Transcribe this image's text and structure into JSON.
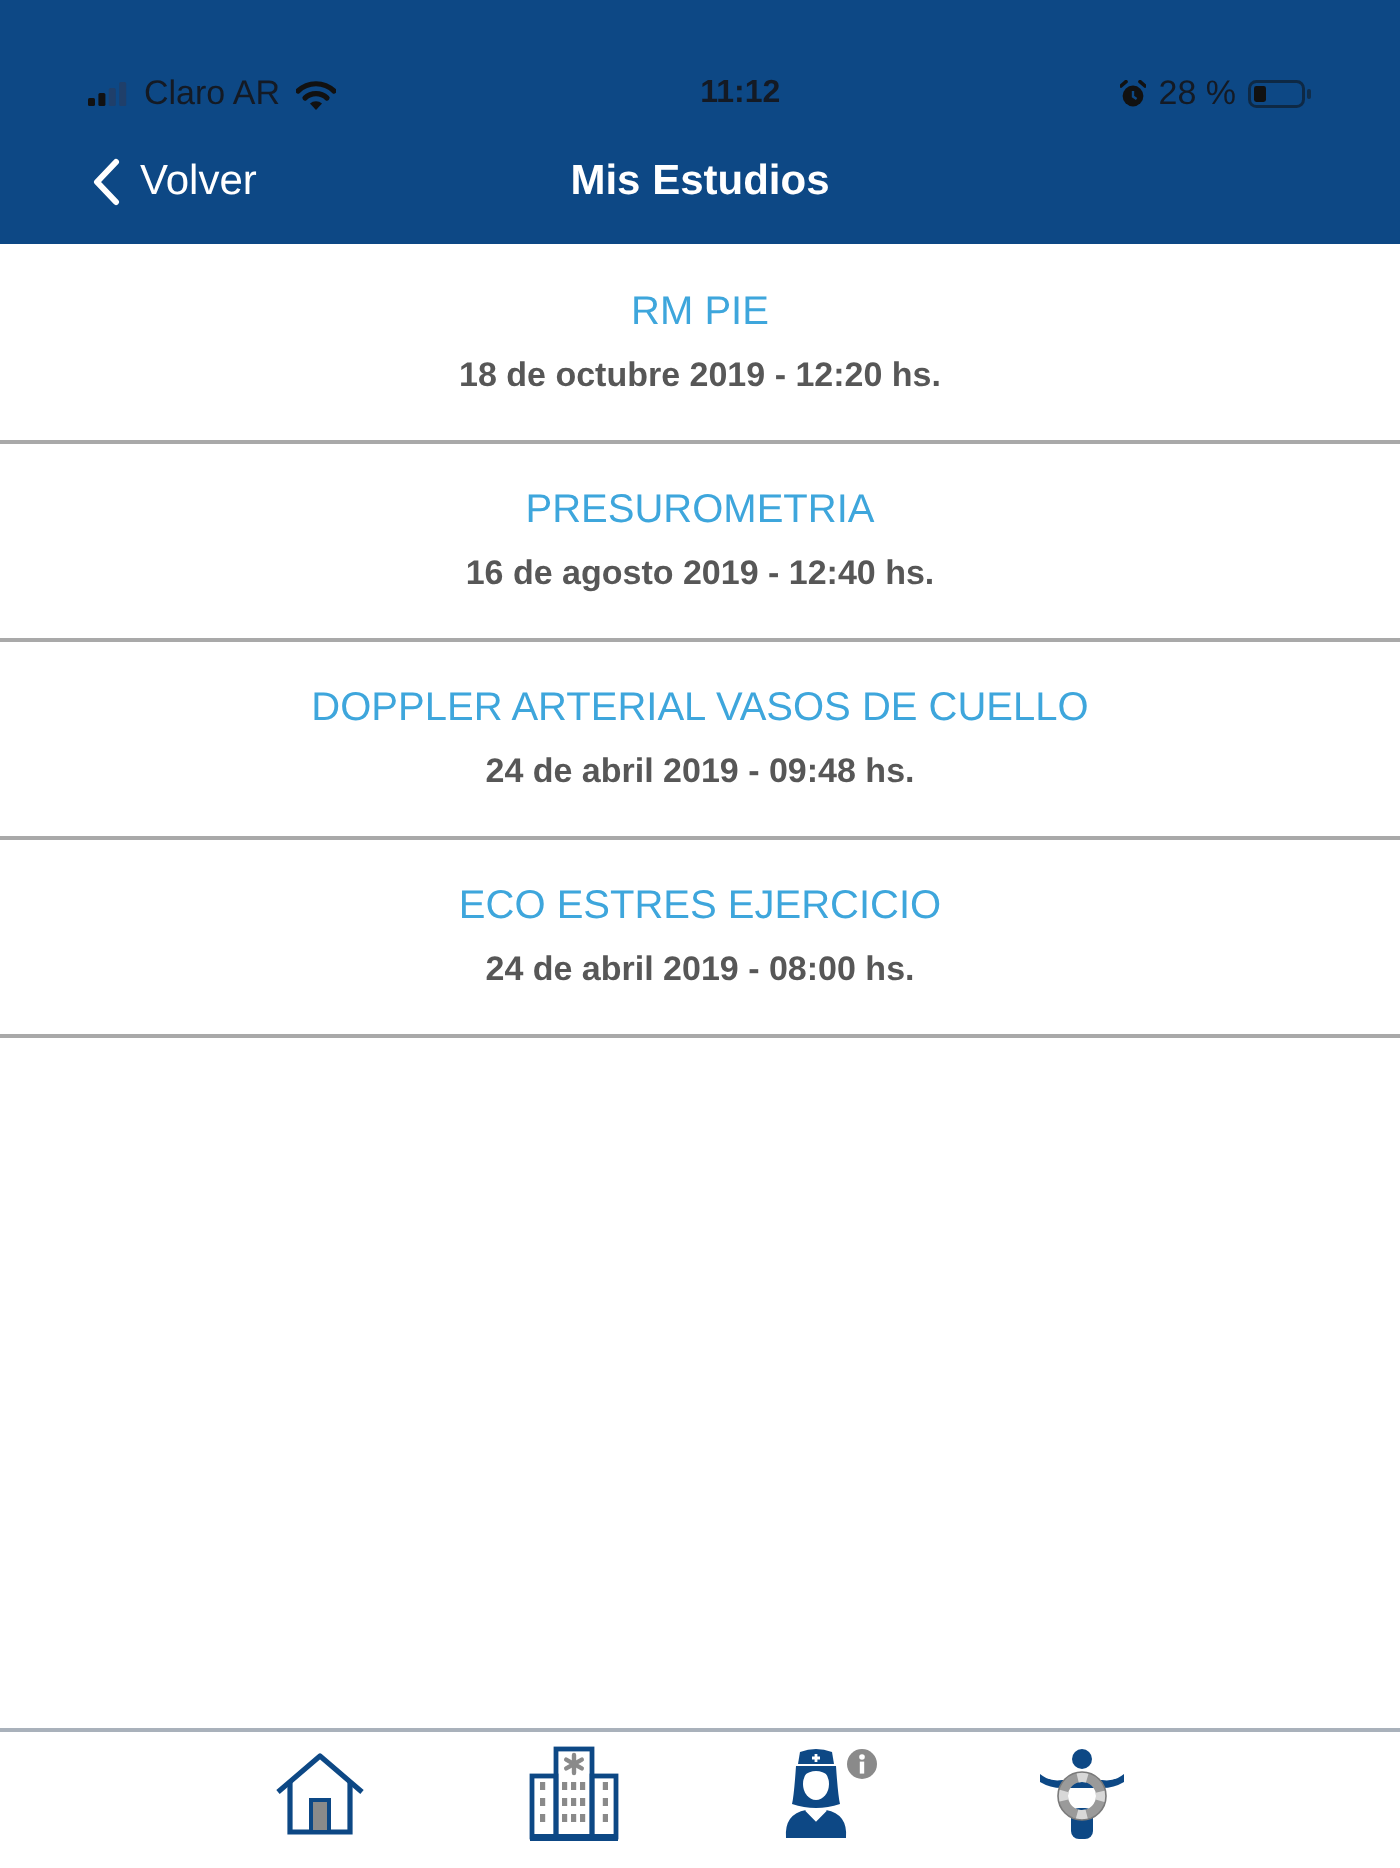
{
  "status_bar": {
    "carrier": "Claro AR",
    "time": "11:12",
    "battery": "28 %"
  },
  "nav_bar": {
    "back": "Volver",
    "title": "Mis Estudios"
  },
  "studies": [
    {
      "name": "RM PIE",
      "date": "18 de octubre 2019 - 12:20 hs."
    },
    {
      "name": "PRESUROMETRIA",
      "date": "16 de agosto 2019 - 12:40 hs."
    },
    {
      "name": "DOPPLER ARTERIAL VASOS DE CUELLO",
      "date": "24 de abril 2019 - 09:48 hs."
    },
    {
      "name": "ECO ESTRES EJERCICIO",
      "date": "24 de abril 2019 - 08:00 hs."
    }
  ],
  "tab_bar": {
    "items": [
      {
        "kind": "home"
      },
      {
        "kind": "hospital"
      },
      {
        "kind": "nurse"
      },
      {
        "kind": "lifebuoy"
      }
    ]
  }
}
